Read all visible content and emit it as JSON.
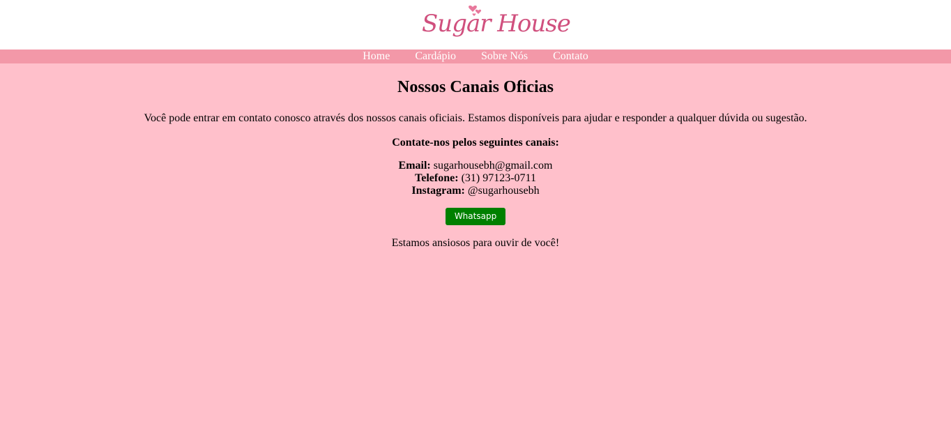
{
  "brand": {
    "logo_text": "Sugar House",
    "logo_color": "#d0507e"
  },
  "nav": {
    "items": [
      {
        "label": "Home"
      },
      {
        "label": "Cardápio"
      },
      {
        "label": "Sobre Nós"
      },
      {
        "label": "Contato"
      }
    ]
  },
  "main": {
    "title": "Nossos Canais Oficias",
    "intro": "Você pode entrar em contato conosco através dos nossos canais oficiais. Estamos disponíveis para ajudar e responder a qualquer dúvida ou sugestão.",
    "channels_heading": "Contate-nos pelos seguintes canais:",
    "contacts": [
      {
        "label": "Email:",
        "value": "sugarhousebh@gmail.com"
      },
      {
        "label": "Telefone:",
        "value": "(31) 97123-0711"
      },
      {
        "label": "Instagram:",
        "value": "@sugarhousebh"
      }
    ],
    "whatsapp_label": "Whatsapp",
    "closing": "Estamos ansiosos para ouvir de você!"
  },
  "colors": {
    "page_background": "#ffc0cb",
    "nav_background": "#f398a8",
    "whatsapp_button": "#008000"
  }
}
